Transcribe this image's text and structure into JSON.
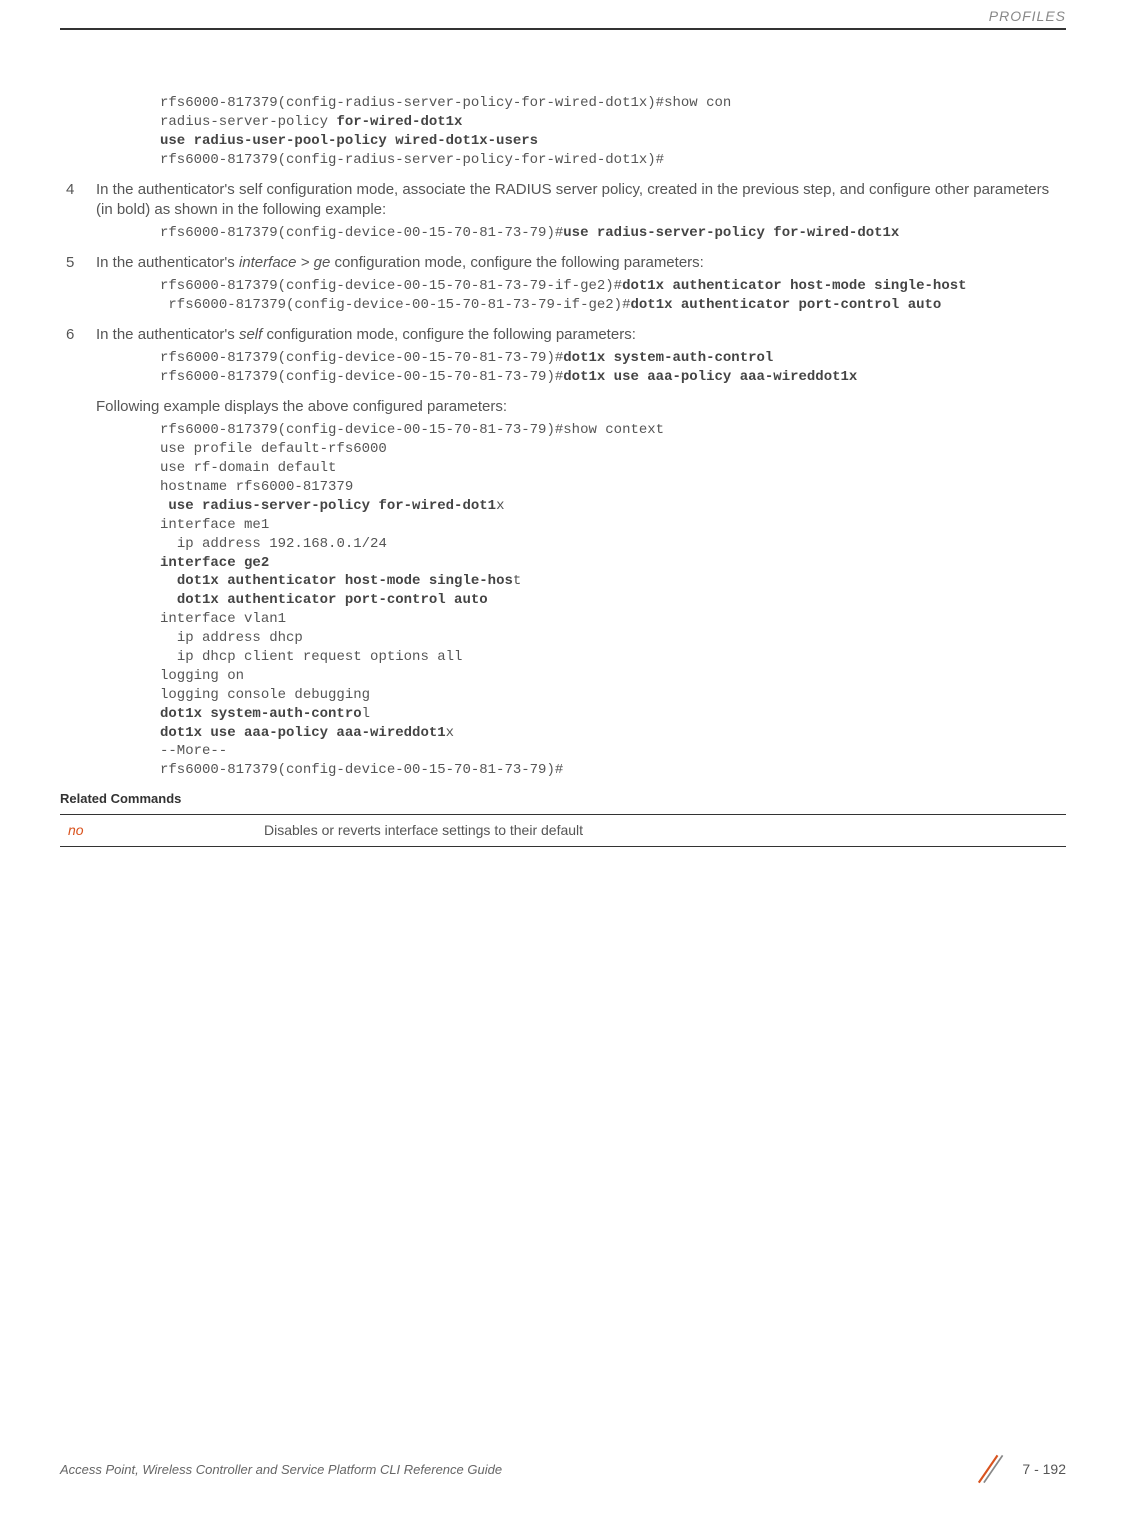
{
  "header": {
    "section": "PROFILES"
  },
  "code1": {
    "l1": "rfs6000-817379(config-radius-server-policy-for-wired-dot1x)#show con",
    "l2a": "radius-server-policy ",
    "l2b": "for-wired-dot1x",
    "l3": "use radius-user-pool-policy wired-dot1x-users",
    "l4": "rfs6000-817379(config-radius-server-policy-for-wired-dot1x)#"
  },
  "step4": {
    "num": "4",
    "text_a": "In the authenticator's self configuration mode, associate the RADIUS server policy, created in the previous step, and configure other parameters (in bold) as shown in the following example:"
  },
  "code2": {
    "l1a": "rfs6000-817379(config-device-00-15-70-81-73-79)#",
    "l1b": "use radius-server-policy for-wired-dot1x"
  },
  "step5": {
    "num": "5",
    "text_a": "In the authenticator's ",
    "text_italic": "interface > ge",
    "text_b": " configuration mode, configure the following parameters:"
  },
  "code3": {
    "l1a": "rfs6000-817379(config-device-00-15-70-81-73-79-if-ge2)#",
    "l1b": "dot1x authenticator host-mode single-host",
    "l2a": " rfs6000-817379(config-device-00-15-70-81-73-79-if-ge2)#",
    "l2b": "dot1x authenticator port-control auto"
  },
  "step6": {
    "num": "6",
    "text_a": "In the authenticator's ",
    "text_italic": "self",
    "text_b": " configuration mode, configure the following parameters:"
  },
  "code4": {
    "l1a": "rfs6000-817379(config-device-00-15-70-81-73-79)#",
    "l1b": "dot1x system-auth-control",
    "l2a": "rfs6000-817379(config-device-00-15-70-81-73-79)#",
    "l2b": "dot1x use aaa-policy aaa-wireddot1x"
  },
  "para_after": "Following example displays the above configured parameters:",
  "code5": {
    "l1": "rfs6000-817379(config-device-00-15-70-81-73-79)#show context",
    "l2": "use profile default-rfs6000",
    "l3": "use rf-domain default",
    "l4": "hostname rfs6000-817379",
    "l5a": " use radius-server-policy for-wired-dot1",
    "l5b": "x",
    "l6": "interface me1",
    "l7": "  ip address 192.168.0.1/24",
    "l8": "interface ge2",
    "l9a": "  dot1x authenticator host-mode single-hos",
    "l9b": "t",
    "l10": "  dot1x authenticator port-control auto",
    "l11": "interface vlan1",
    "l12": "  ip address dhcp",
    "l13": "  ip dhcp client request options all",
    "l14": "logging on",
    "l15": "logging console debugging",
    "l16a": "dot1x system-auth-contro",
    "l16b": "l",
    "l17a": "dot1x use aaa-policy aaa-wireddot1",
    "l17b": "x",
    "l18": "--More--",
    "l19": "rfs6000-817379(config-device-00-15-70-81-73-79)#"
  },
  "related": {
    "heading": "Related Commands",
    "cmd": "no",
    "desc": "Disables or reverts interface settings to their default"
  },
  "footer": {
    "title": "Access Point, Wireless Controller and Service Platform CLI Reference Guide",
    "page": "7 - 192"
  }
}
